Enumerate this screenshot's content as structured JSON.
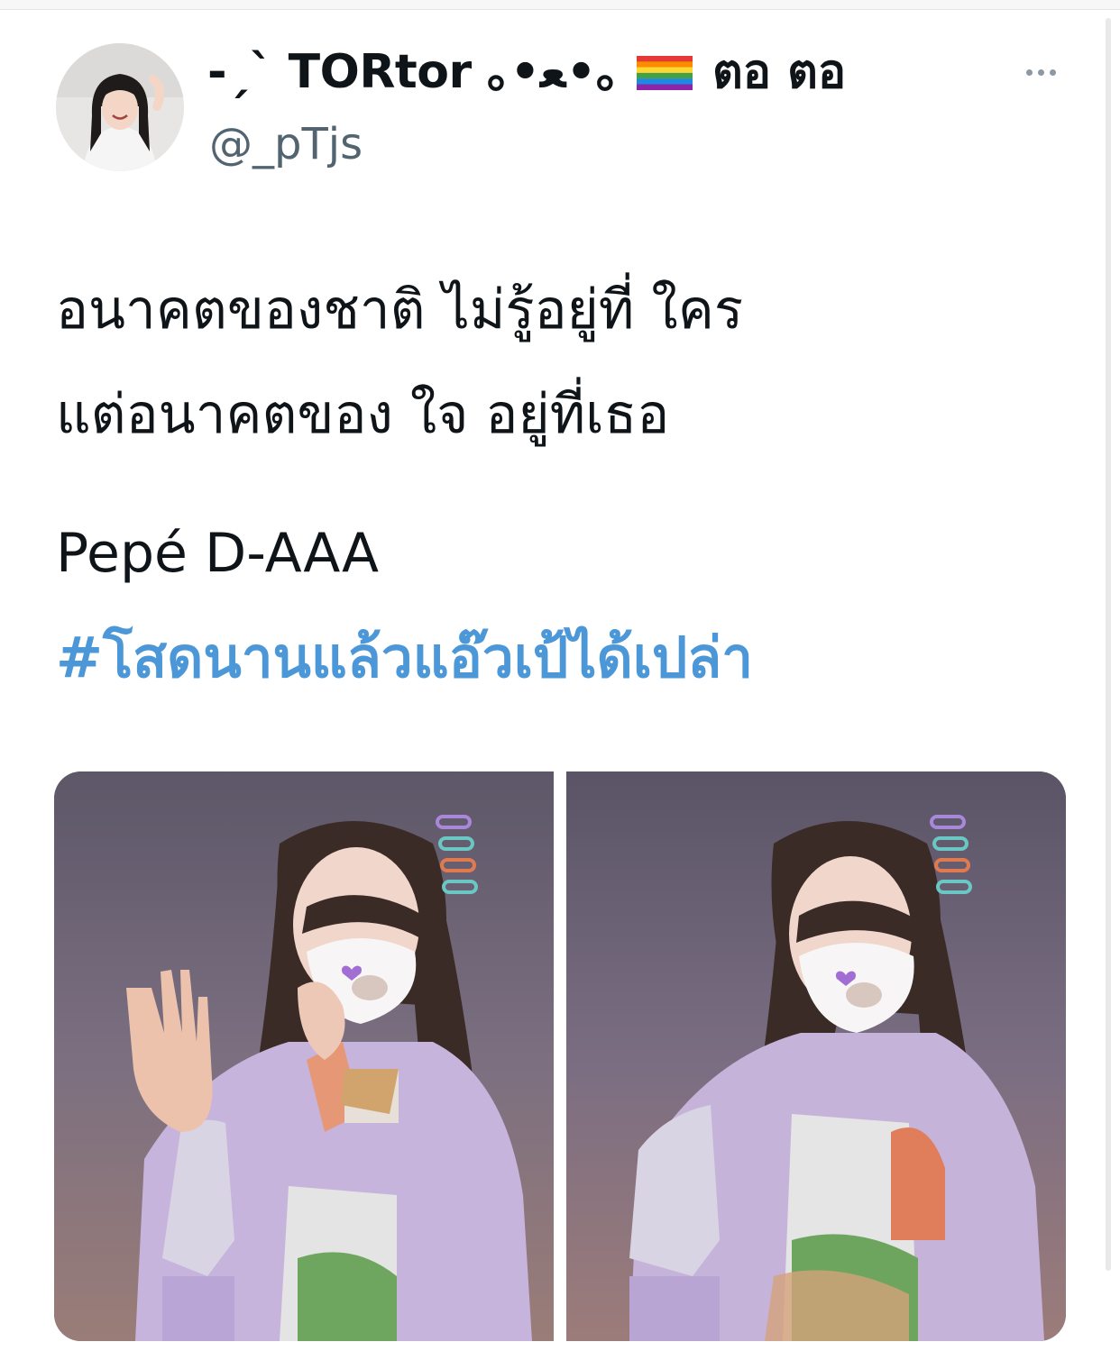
{
  "tweet": {
    "author": {
      "display_name": "-ˏˋ TORtor ｡•ﻌ•｡",
      "display_name_suffix": "ตอ ตอ",
      "handle": "@_pTjs",
      "avatar_icon": "profile-photo",
      "flag_icon": "rainbow-flag"
    },
    "more_icon": "more-horizontal-icon",
    "text_lines": [
      "อนาคตของชาติ ไม่รู้อยู่ที่ ใคร",
      "แต่อนาคตของ ใจ อยู่ที่เธอ",
      "Pepé D-AAA"
    ],
    "hashtag": "#โสดนานแล้วแอ๊วเป้ได้เปล่า",
    "hashtag_color": "#4b97d7",
    "media": [
      {
        "icon": "photo-girl-waving"
      },
      {
        "icon": "photo-girl-smiling"
      }
    ]
  }
}
